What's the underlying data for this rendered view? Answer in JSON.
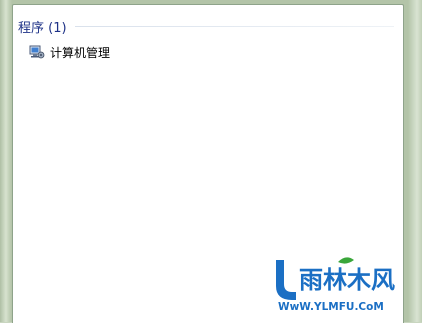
{
  "results": {
    "section_title": "程序 (1)",
    "items": [
      {
        "label": "计算机管理",
        "icon": "computer-management-icon"
      }
    ]
  },
  "watermark": {
    "brand": "雨林木风",
    "url": "WwW.YLMFU.CoM",
    "colors": {
      "blue": "#1b6fc4",
      "green": "#3aa63a"
    }
  }
}
